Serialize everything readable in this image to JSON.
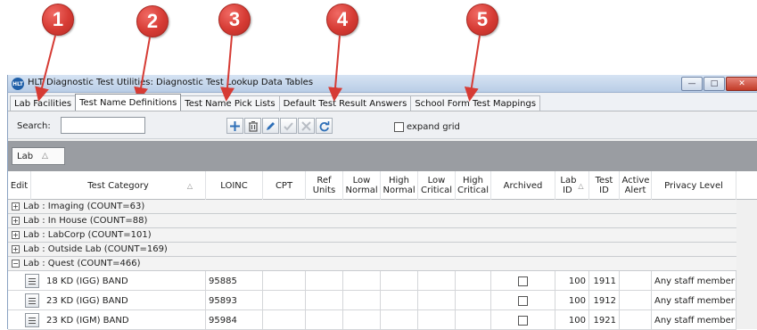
{
  "callouts": [
    "1",
    "2",
    "3",
    "4",
    "5"
  ],
  "window": {
    "app_icon": "hlt-logo-icon",
    "title": "HLT Diagnostic Test Utilities:  Diagnostic Test Lookup Data Tables",
    "controls": [
      "minimize-icon",
      "maximize-icon",
      "close-icon"
    ]
  },
  "tabs": [
    {
      "label": "Lab Facilities"
    },
    {
      "label": "Test Name Definitions",
      "active": true
    },
    {
      "label": "Test Name Pick Lists"
    },
    {
      "label": "Default Test Result Answers"
    },
    {
      "label": "School Form Test Mappings"
    }
  ],
  "toolbar": {
    "search_label": "Search:",
    "search_value": "",
    "buttons": [
      "add-icon",
      "delete-icon",
      "edit-icon",
      "save-icon",
      "cancel-icon",
      "refresh-icon"
    ],
    "expand_label": "expand grid",
    "expand_checked": false
  },
  "group_panel": {
    "chip_label": "Lab",
    "sort_glyph": "△"
  },
  "grid": {
    "sort_glyph": "△",
    "columns": {
      "edit": "Edit",
      "test_category": "Test Category",
      "loinc": "LOINC",
      "cpt": "CPT",
      "ref_units": "Ref Units",
      "low_normal": "Low Normal",
      "high_normal": "High Normal",
      "low_critical": "Low Critical",
      "high_critical": "High Critical",
      "archived": "Archived",
      "lab_id": "Lab ID",
      "test_id": "Test ID",
      "active_alert": "Active Alert",
      "privacy_level": "Privacy Level"
    },
    "groups": [
      {
        "label": "Lab : Imaging (COUNT=63)",
        "expanded": false
      },
      {
        "label": "Lab : In House (COUNT=88)",
        "expanded": false
      },
      {
        "label": "Lab : LabCorp (COUNT=101)",
        "expanded": false
      },
      {
        "label": "Lab : Outside Lab (COUNT=169)",
        "expanded": false
      },
      {
        "label": "Lab : Quest (COUNT=466)",
        "expanded": true
      }
    ],
    "expand_glyph": "+",
    "collapse_glyph": "−",
    "rows": [
      {
        "test_category": "18 KD (IGG) BAND",
        "loinc": "95885",
        "archived": false,
        "lab_id": "100",
        "test_id": "1911",
        "privacy": "Any staff member"
      },
      {
        "test_category": "23 KD (IGG) BAND",
        "loinc": "95893",
        "archived": false,
        "lab_id": "100",
        "test_id": "1912",
        "privacy": "Any staff member"
      },
      {
        "test_category": "23 KD (IGM) BAND",
        "loinc": "95984",
        "archived": false,
        "lab_id": "100",
        "test_id": "1921",
        "privacy": "Any staff member"
      }
    ]
  }
}
